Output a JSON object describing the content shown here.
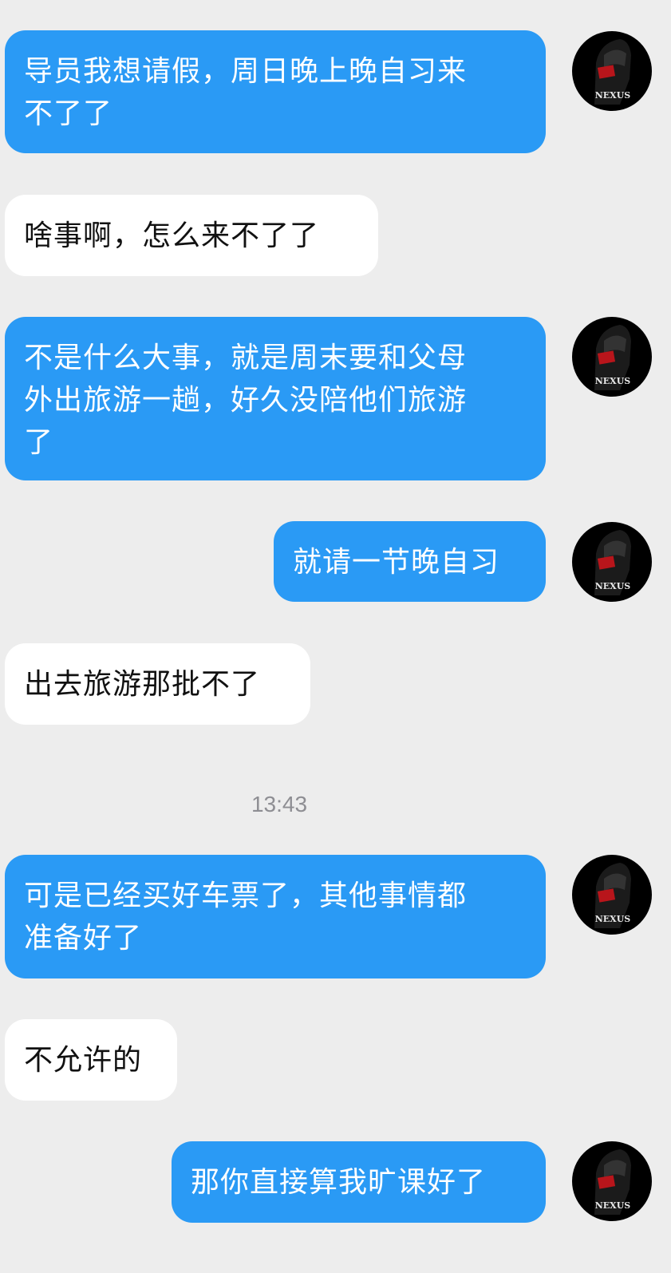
{
  "messages": [
    {
      "side": "out",
      "text": "导员我想请假，周日晚上晚自习来\n不了了"
    },
    {
      "side": "in",
      "text": "啥事啊，怎么来不了了"
    },
    {
      "side": "out",
      "text": "不是什么大事，就是周末要和父母\n外出旅游一趟，好久没陪他们旅游\n了"
    },
    {
      "side": "out",
      "text": "就请一节晚自习"
    },
    {
      "side": "in",
      "text": "出去旅游那批不了"
    },
    {
      "side": "out",
      "text": "可是已经买好车票了，其他事情都\n准备好了"
    },
    {
      "side": "in",
      "text": "不允许的"
    },
    {
      "side": "out",
      "text": "那你直接算我旷课好了"
    }
  ],
  "timestamp": "13:43",
  "avatar": {
    "brand_text": "NEXUS",
    "icon": "helmet-logo-icon"
  },
  "colors": {
    "outgoing": "#2a9af5",
    "incoming": "#ffffff",
    "background": "#ededed"
  }
}
